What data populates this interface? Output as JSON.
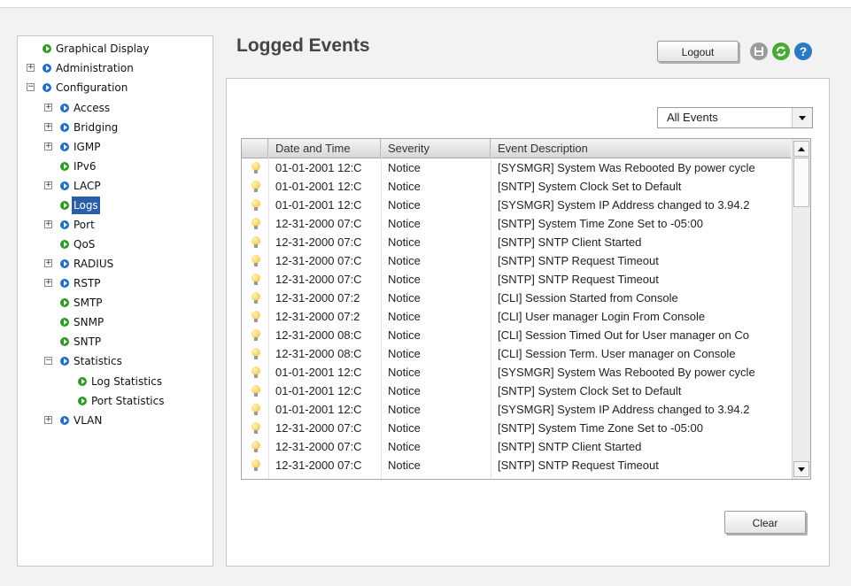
{
  "page_title": "Logged Events",
  "logout_label": "Logout",
  "clear_label": "Clear",
  "filter": {
    "selected": "All Events"
  },
  "icons": {
    "save": "save-icon",
    "refresh": "refresh-icon",
    "help": "help-icon",
    "row": "lightbulb-icon"
  },
  "colors": {
    "selected_nav": "#2a5ea8",
    "leaf_dot": "#2f9a22",
    "branch_dot": "#1f6fc4",
    "help": "#2a7bc6",
    "refresh": "#48a935"
  },
  "sidebar": {
    "items": [
      {
        "label": "Graphical Display",
        "type": "leaf"
      },
      {
        "label": "Administration",
        "type": "branch",
        "state": "collapsed"
      },
      {
        "label": "Configuration",
        "type": "branch",
        "state": "expanded"
      },
      {
        "label": "Access",
        "type": "branch",
        "state": "collapsed"
      },
      {
        "label": "Bridging",
        "type": "branch",
        "state": "collapsed"
      },
      {
        "label": "IGMP",
        "type": "branch",
        "state": "collapsed"
      },
      {
        "label": "IPv6",
        "type": "leaf"
      },
      {
        "label": "LACP",
        "type": "branch",
        "state": "collapsed"
      },
      {
        "label": "Logs",
        "type": "leaf",
        "selected": true
      },
      {
        "label": "Port",
        "type": "branch",
        "state": "collapsed"
      },
      {
        "label": "QoS",
        "type": "leaf"
      },
      {
        "label": "RADIUS",
        "type": "branch",
        "state": "collapsed"
      },
      {
        "label": "RSTP",
        "type": "branch",
        "state": "collapsed"
      },
      {
        "label": "SMTP",
        "type": "leaf"
      },
      {
        "label": "SNMP",
        "type": "leaf"
      },
      {
        "label": "SNTP",
        "type": "leaf"
      },
      {
        "label": "Statistics",
        "type": "branch",
        "state": "expanded"
      },
      {
        "label": "Log Statistics",
        "type": "leaf"
      },
      {
        "label": "Port Statistics",
        "type": "leaf"
      },
      {
        "label": "VLAN",
        "type": "branch",
        "state": "collapsed"
      }
    ]
  },
  "table": {
    "columns": [
      "Date and Time",
      "Severity",
      "Event Description"
    ],
    "rows": [
      [
        "01-01-2001 12:C",
        "Notice",
        "[SYSMGR] System Was Rebooted By power cycle"
      ],
      [
        "01-01-2001 12:C",
        "Notice",
        "[SNTP] System Clock Set to Default"
      ],
      [
        "01-01-2001 12:C",
        "Notice",
        "[SYSMGR] System IP Address changed to 3.94.2"
      ],
      [
        "12-31-2000 07:C",
        "Notice",
        "[SNTP] System Time Zone Set to -05:00"
      ],
      [
        "12-31-2000 07:C",
        "Notice",
        "[SNTP] SNTP Client Started"
      ],
      [
        "12-31-2000 07:C",
        "Notice",
        "[SNTP] SNTP Request Timeout"
      ],
      [
        "12-31-2000 07:C",
        "Notice",
        "[SNTP] SNTP Request Timeout"
      ],
      [
        "12-31-2000 07:2",
        "Notice",
        "[CLI] Session Started from Console"
      ],
      [
        "12-31-2000 07:2",
        "Notice",
        "[CLI] User manager Login From Console"
      ],
      [
        "12-31-2000 08:C",
        "Notice",
        "[CLI] Session Timed Out for User manager on Co"
      ],
      [
        "12-31-2000 08:C",
        "Notice",
        "[CLI] Session Term. User manager on Console"
      ],
      [
        "01-01-2001 12:C",
        "Notice",
        "[SYSMGR] System Was Rebooted By power cycle"
      ],
      [
        "01-01-2001 12:C",
        "Notice",
        "[SNTP] System Clock Set to Default"
      ],
      [
        "01-01-2001 12:C",
        "Notice",
        "[SYSMGR] System IP Address changed to 3.94.2"
      ],
      [
        "12-31-2000 07:C",
        "Notice",
        "[SNTP] System Time Zone Set to -05:00"
      ],
      [
        "12-31-2000 07:C",
        "Notice",
        "[SNTP] SNTP Client Started"
      ],
      [
        "12-31-2000 07:C",
        "Notice",
        "[SNTP] SNTP Request Timeout"
      ]
    ]
  }
}
